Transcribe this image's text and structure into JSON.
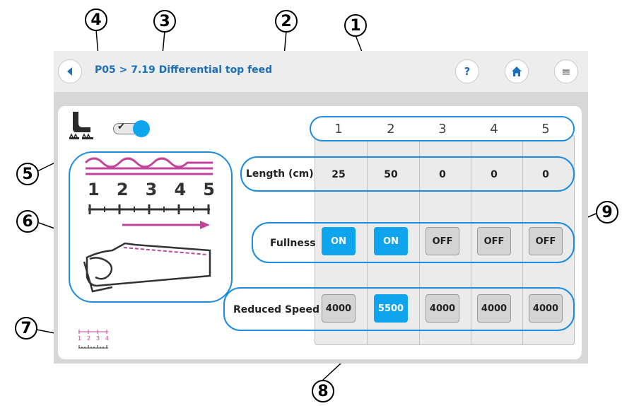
{
  "header": {
    "title": "P05 > 7.19 Differential top feed",
    "back_icon": "back-arrow-icon",
    "help_label": "?",
    "home_icon": "home-icon",
    "menu_label": "≡"
  },
  "callouts": [
    "1",
    "2",
    "3",
    "4",
    "5",
    "6",
    "7",
    "8",
    "9"
  ],
  "feature_toggle": {
    "checked": true,
    "icon": "presser-foot-icon"
  },
  "illustration": {
    "scale_labels": [
      "1",
      "2",
      "3",
      "4",
      "5"
    ],
    "small_scale_labels": [
      "1",
      "2",
      "3",
      "4"
    ]
  },
  "columns": [
    "1",
    "2",
    "3",
    "4",
    "5"
  ],
  "rows": {
    "length": {
      "label": "Length (cm)",
      "values": [
        "25",
        "50",
        "0",
        "0",
        "0"
      ]
    },
    "fullness": {
      "label": "Fullness",
      "values": [
        "ON",
        "ON",
        "OFF",
        "OFF",
        "OFF"
      ]
    },
    "reduced_speed": {
      "label": "Reduced Speed",
      "values": [
        "4000",
        "5500",
        "4000",
        "4000",
        "4000"
      ],
      "selected_index": 1
    }
  },
  "colors": {
    "accent": "#0ea5ee",
    "outline": "#1c8be0",
    "title": "#1c6fb8",
    "fabric": "#c2449a"
  }
}
